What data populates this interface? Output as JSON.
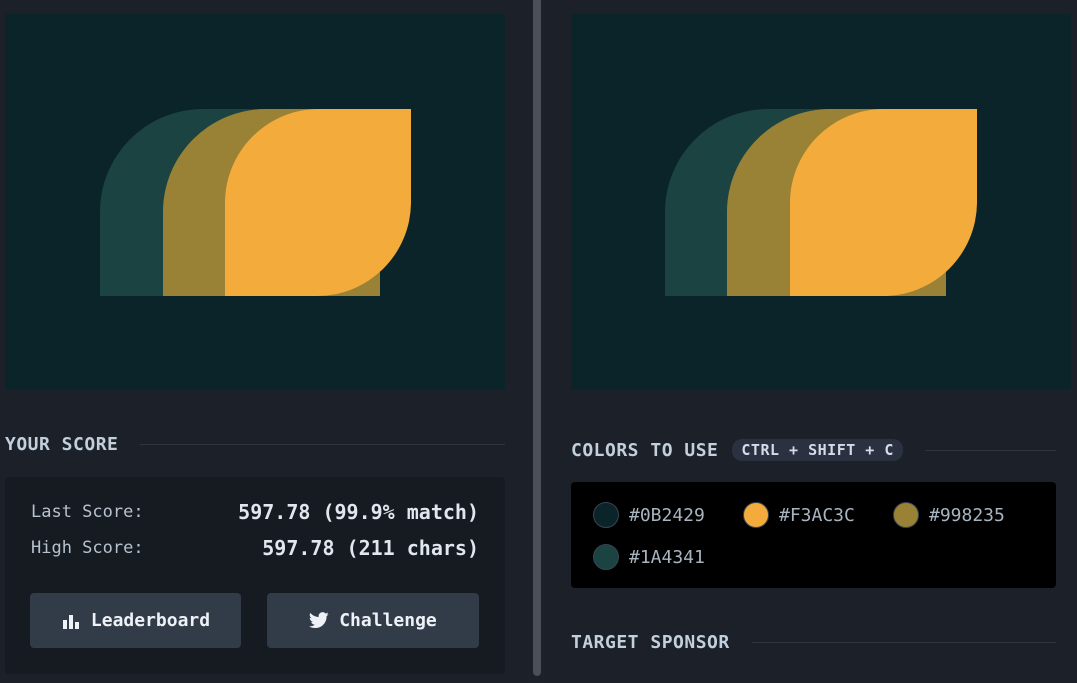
{
  "left": {
    "score_heading": "YOUR SCORE",
    "last_score_label": "Last Score:",
    "last_score_value": "597.78 (99.9% match)",
    "high_score_label": "High Score:",
    "high_score_value": "597.78 (211 chars)",
    "leaderboard_label": "Leaderboard",
    "challenge_label": "Challenge",
    "leaderboard_icon": "bar-chart-icon",
    "challenge_icon": "twitter-icon"
  },
  "right": {
    "colors_heading": "COLORS TO USE",
    "shortcut": "CTRL + SHIFT + C",
    "sponsor_heading": "TARGET SPONSOR",
    "colors": [
      {
        "hex": "#0B2429"
      },
      {
        "hex": "#F3AC3C"
      },
      {
        "hex": "#998235"
      },
      {
        "hex": "#1A4341"
      }
    ]
  },
  "theme": {
    "background": "#0B2429",
    "accent": "#F3AC3C",
    "mid": "#998235",
    "dark_green": "#1A4341"
  }
}
